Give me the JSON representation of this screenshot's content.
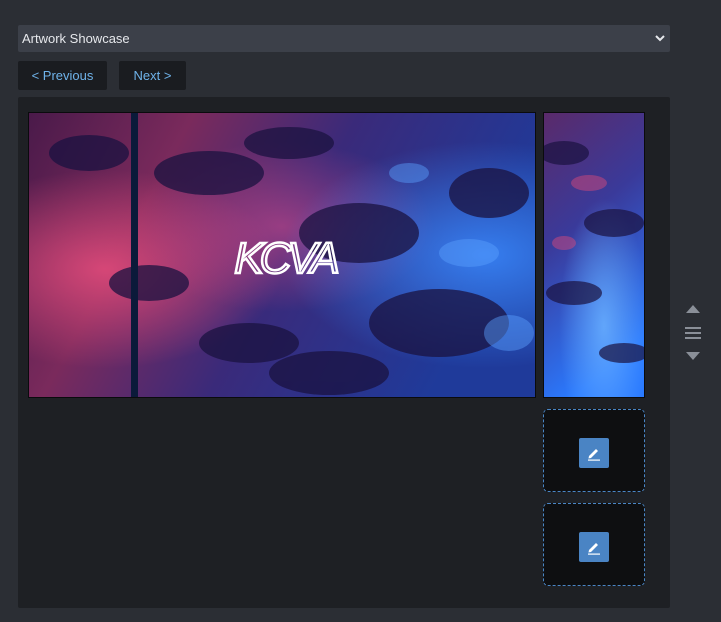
{
  "selector": {
    "selected": "Artwork Showcase"
  },
  "nav": {
    "previous_label": "< Previous",
    "next_label": "Next >"
  },
  "artwork": {
    "logo_text": "KCVA"
  },
  "colors": {
    "accent": "#4a84c4",
    "link": "#6fb3ea",
    "panel": "#1e2024",
    "background": "#2b2e34"
  },
  "icons": {
    "select_arrow": "chevron-down-icon",
    "edit": "pencil-icon",
    "move_up": "triangle-up-icon",
    "drag": "drag-handle-icon",
    "move_down": "triangle-down-icon"
  }
}
